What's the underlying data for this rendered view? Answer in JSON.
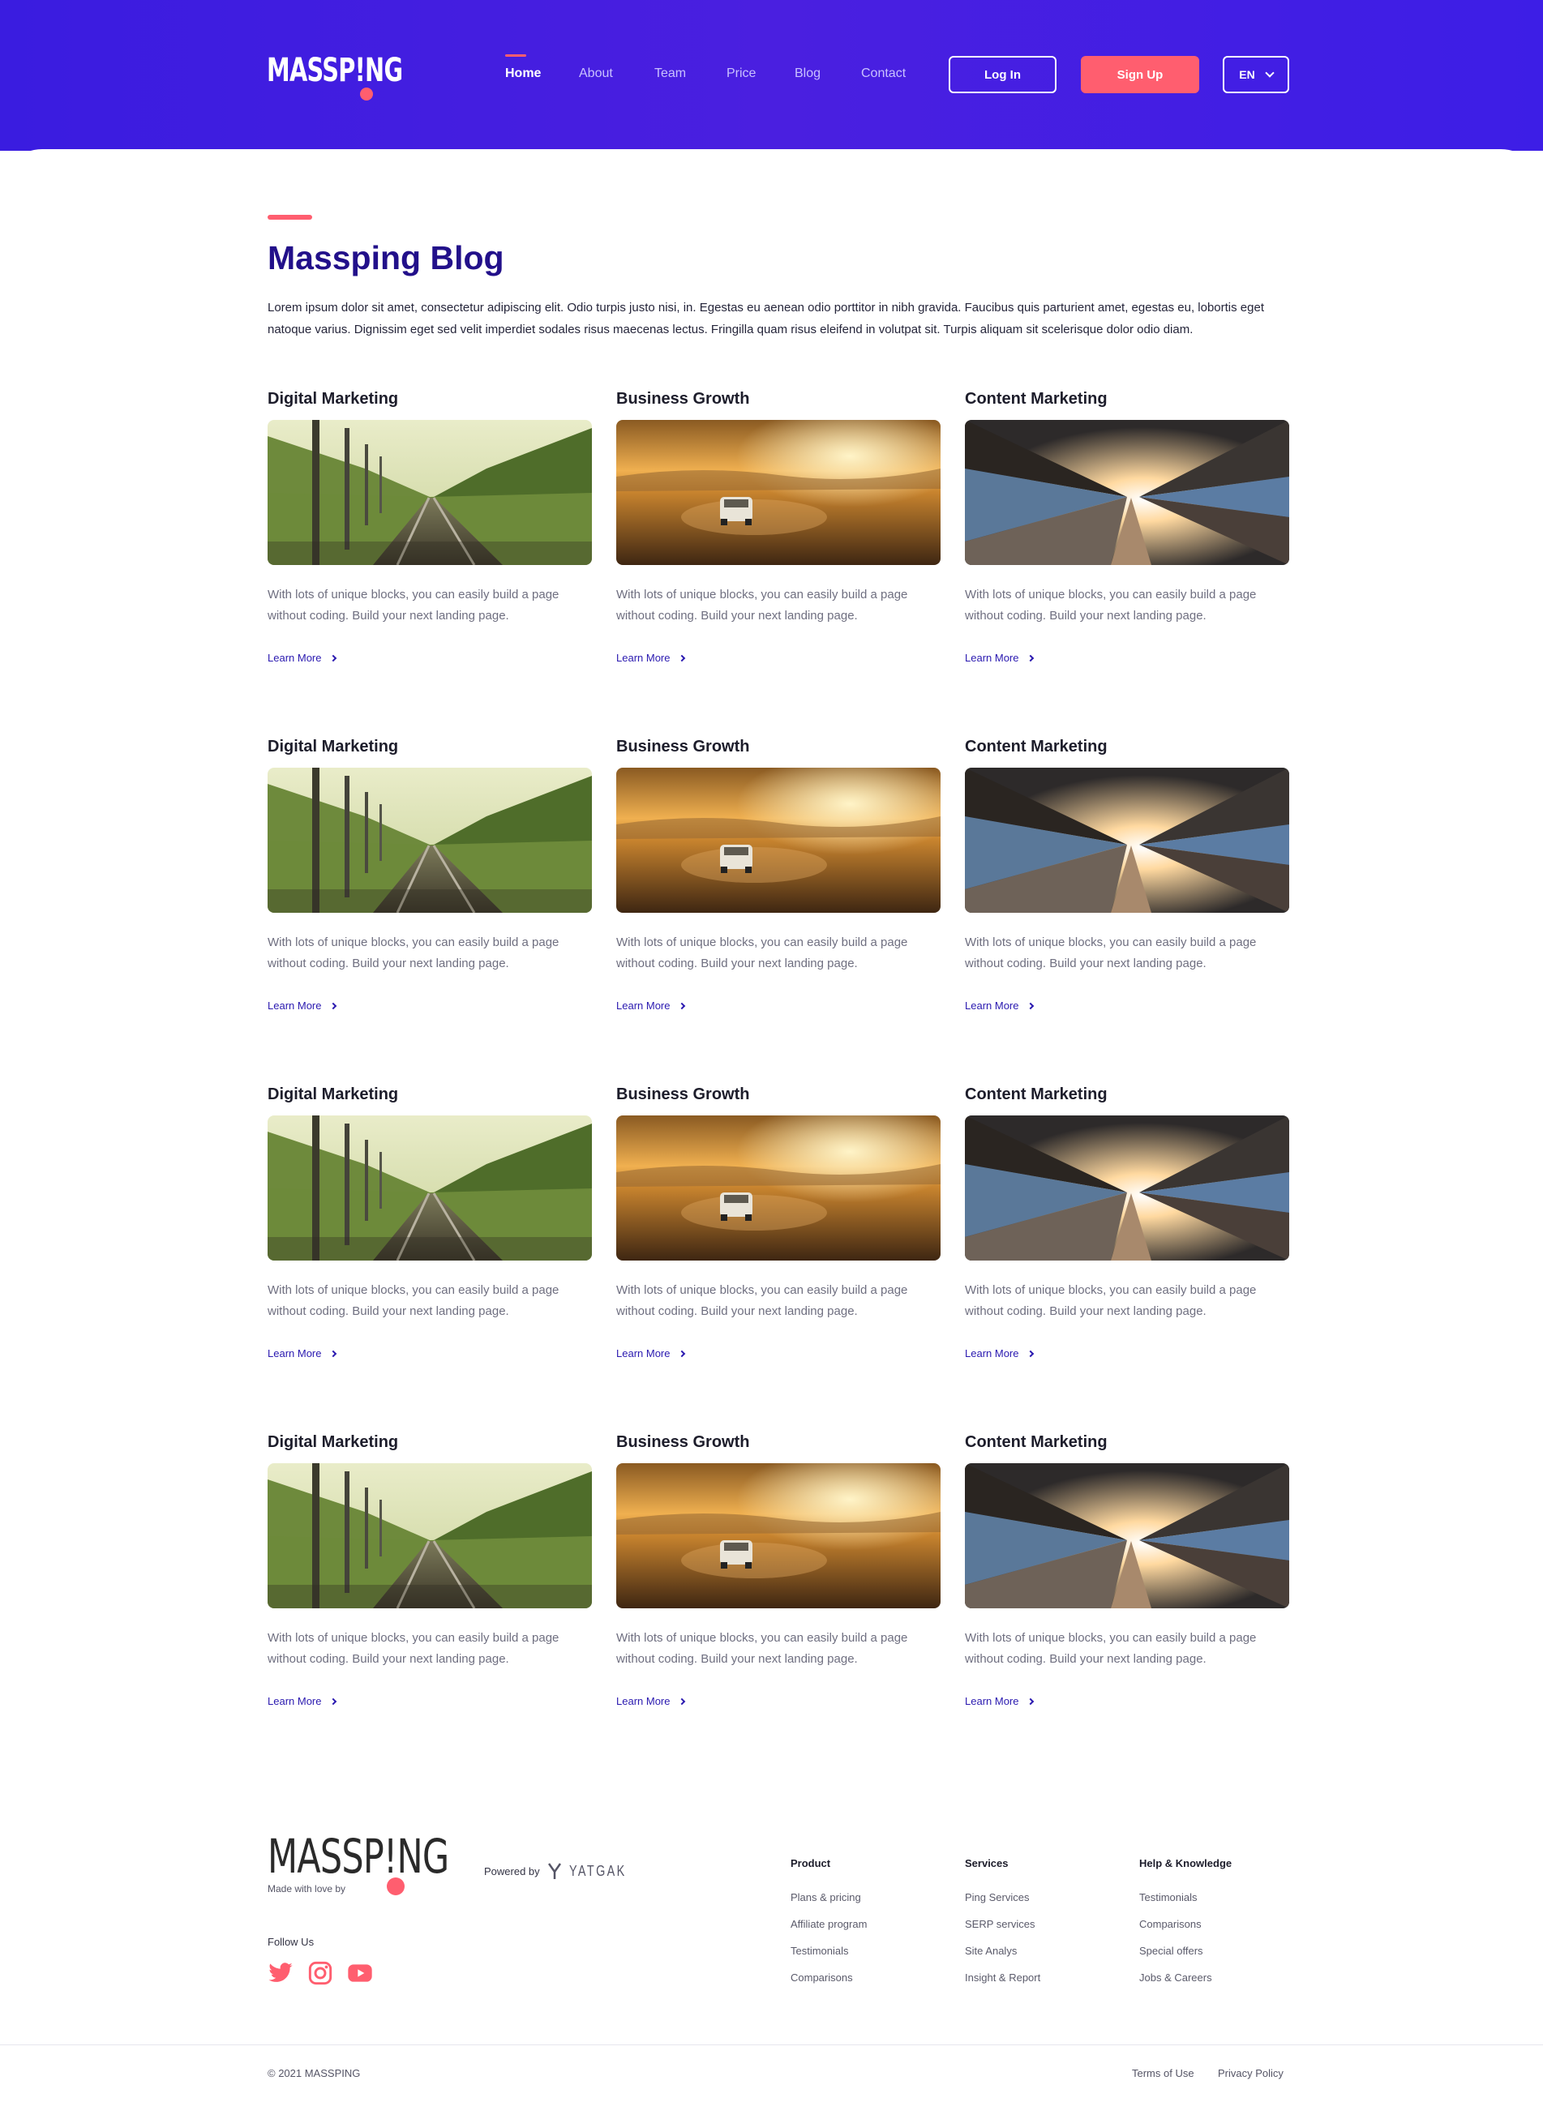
{
  "header": {
    "logo_text": "MASSP!NG",
    "nav": [
      "Home",
      "About",
      "Team",
      "Price",
      "Blog",
      "Contact"
    ],
    "active_nav": "Home",
    "login_label": "Log In",
    "signup_label": "Sign Up",
    "language": "EN"
  },
  "intro": {
    "title": "Massping Blog",
    "text": "Lorem ipsum dolor sit amet, consectetur adipiscing elit. Odio turpis justo nisi, in. Egestas eu aenean odio porttitor in nibh gravida. Faucibus quis parturient amet, egestas eu, lobortis eget natoque varius. Dignissim eget sed velit imperdiet sodales risus maecenas lectus. Fringilla quam risus eleifend in volutpat sit. Turpis aliquam sit scelerisque dolor odio diam."
  },
  "rows": [
    [
      {
        "title": "Digital Marketing",
        "image": "railway-track-photo",
        "text": "With lots of unique blocks, you can easily build a page without coding. Build your next landing page.",
        "link": "Learn More"
      },
      {
        "title": "Business Growth",
        "image": "car-sunset-desert-photo",
        "text": "With lots of unique blocks, you can easily build a page without coding. Build your next landing page.",
        "link": "Learn More"
      },
      {
        "title": "Content Marketing",
        "image": "station-platform-sunset-photo",
        "text": "With lots of unique blocks, you can easily build a page without coding. Build your next landing page.",
        "link": "Learn More"
      }
    ],
    [
      {
        "title": "Digital Marketing",
        "image": "railway-track-photo",
        "text": "With lots of unique blocks, you can easily build a page without coding. Build your next landing page.",
        "link": "Learn More"
      },
      {
        "title": "Business Growth",
        "image": "car-sunset-desert-photo",
        "text": "With lots of unique blocks, you can easily build a page without coding. Build your next landing page.",
        "link": "Learn More"
      },
      {
        "title": "Content Marketing",
        "image": "station-platform-sunset-photo",
        "text": "With lots of unique blocks, you can easily build a page without coding. Build your next landing page.",
        "link": "Learn More"
      }
    ],
    [
      {
        "title": "Digital Marketing",
        "image": "railway-track-photo",
        "text": "With lots of unique blocks, you can easily build a page without coding. Build your next landing page.",
        "link": "Learn More"
      },
      {
        "title": "Business Growth",
        "image": "car-sunset-desert-photo",
        "text": "With lots of unique blocks, you can easily build a page without coding. Build your next landing page.",
        "link": "Learn More"
      },
      {
        "title": "Content Marketing",
        "image": "station-platform-sunset-photo",
        "text": "With lots of unique blocks, you can easily build a page without coding. Build your next landing page.",
        "link": "Learn More"
      }
    ],
    [
      {
        "title": "Digital Marketing",
        "image": "railway-track-photo",
        "text": "With lots of unique blocks, you can easily build a page without coding. Build your next landing page.",
        "link": "Learn More"
      },
      {
        "title": "Business Growth",
        "image": "car-sunset-desert-photo",
        "text": "With lots of unique blocks, you can easily build a page without coding. Build your next landing page.",
        "link": "Learn More"
      },
      {
        "title": "Content Marketing",
        "image": "station-platform-sunset-photo",
        "text": "With lots of unique blocks, you can easily build a page without coding. Build your next landing page.",
        "link": "Learn More"
      }
    ]
  ],
  "footer": {
    "logo_text": "MASSP!NG",
    "made_with": "Made with love by",
    "powered_by": "Powered by",
    "powered_brand": "YATGAK",
    "follow_us": "Follow Us",
    "social_icons": [
      "twitter-icon",
      "instagram-icon",
      "youtube-icon"
    ],
    "columns": [
      {
        "heading": "Product",
        "items": [
          "Plans & pricing",
          "Affiliate program",
          "Testimonials",
          "Comparisons"
        ]
      },
      {
        "heading": "Services",
        "items": [
          "Ping Services",
          "SERP services",
          "Site Analys",
          "Insight & Report"
        ]
      },
      {
        "heading": "Help & Knowledge",
        "items": [
          "Testimonials",
          "Comparisons",
          "Special offers",
          "Jobs & Careers"
        ]
      }
    ],
    "copyright": "© 2021 MASSPING",
    "terms": "Terms of Use",
    "privacy": "Privacy Policy"
  },
  "colors": {
    "header_bg": "#3d1ee6",
    "accent": "#ff5e6f",
    "title": "#22108a",
    "link": "#2a19b0"
  }
}
